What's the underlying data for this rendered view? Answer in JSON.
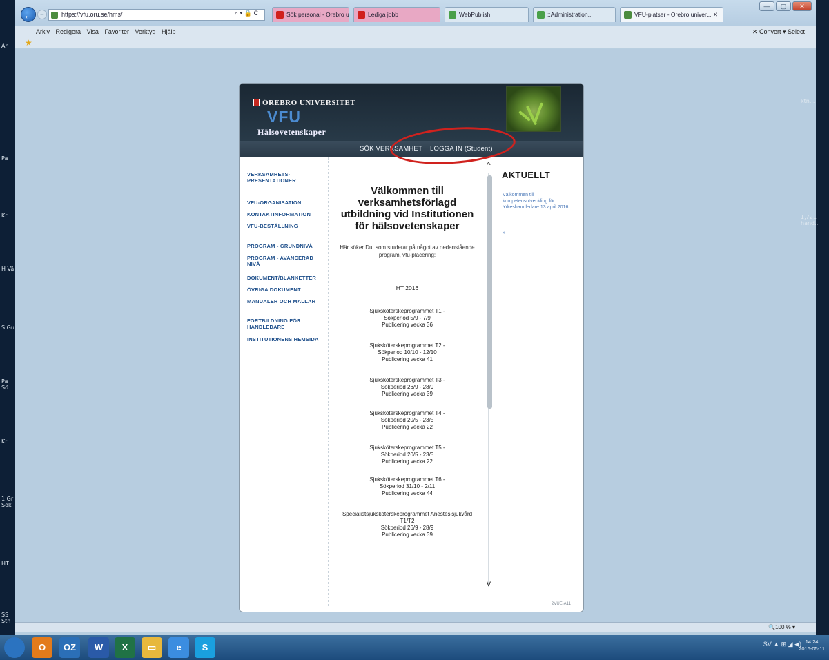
{
  "browser": {
    "url": "https://vfu.oru.se/hms/",
    "address_tools": "⌕ ▾ 🔒 C",
    "tabs": [
      {
        "label": "Sök personal - Örebro universi...",
        "color": "#e8a8c4",
        "icon_color": "#d0201c"
      },
      {
        "label": "Lediga jobb",
        "color": "#e8a8c4",
        "icon_color": "#d0201c"
      },
      {
        "label": "WebPublish",
        "color": "#dce8f2",
        "icon_color": "#4aa04a"
      },
      {
        "label": "::Administration...",
        "color": "#dce8f2",
        "icon_color": "#4aa04a"
      },
      {
        "label": "VFU-platser - Örebro univer... ✕",
        "color": "#f2f6fa",
        "icon_color": "#4c8c3f"
      }
    ],
    "menu": [
      "Arkiv",
      "Redigera",
      "Visa",
      "Favoriter",
      "Verktyg",
      "Hjälp"
    ],
    "menu_right": "✕  Convert ▾  Select",
    "zoom": "🔍100 % ▾",
    "window_buttons": {
      "minimize": "—",
      "maximize": "▢",
      "close": "✕"
    }
  },
  "site": {
    "university": "ÖREBRO UNIVERSITET",
    "title": "VFU",
    "subtitle": "Hälsovetenskaper",
    "nav": {
      "search": "SÖK VERKSAMHET",
      "login": "LOGGA IN (Student)"
    },
    "left_menu": [
      "VERKSAMHETS-PRESENTATIONER",
      "VFU-ORGANISATION",
      "KONTAKTINFORMATION",
      "VFU-BESTÄLLNING",
      "PROGRAM - GRUNDNIVÅ",
      "PROGRAM - AVANCERAD NIVÅ",
      "DOKUMENT/BLANKETTER",
      "ÖVRIGA DOKUMENT",
      "MANUALER OCH MALLAR",
      "FORTBILDNING FÖR HANDLEDARE",
      "INSTITUTIONENS HEMSIDA"
    ],
    "welcome": "Välkommen till verksamhetsförlagd utbildning vid Institutionen för hälsovetenskaper",
    "intro": "Här söker Du, som studerar på något av nedanstående program, vfu-placering:",
    "term": "HT 2016",
    "programs": [
      {
        "name": "Sjuksköterskeprogrammet T1 -",
        "period": "Sökperiod 5/9 - 7/9",
        "publish": "Publicering vecka 36"
      },
      {
        "name": "Sjuksköterskeprogrammet T2 -",
        "period": "Sökperiod 10/10 - 12/10",
        "publish": "Publicering vecka 41"
      },
      {
        "name": "Sjuksköterskeprogrammet T3 -",
        "period": "Sökperiod 26/9 - 28/9",
        "publish": "Publicering vecka 39"
      },
      {
        "name": "Sjuksköterskeprogrammet T4 -",
        "period": "Sökperiod 20/5 - 23/5",
        "publish": "Publicering vecka 22"
      },
      {
        "name": "Sjuksköterskeprogrammet T5 -",
        "period": "Sökperiod 20/5 - 23/5",
        "publish": "Publicering vecka 22"
      },
      {
        "name": "Sjuksköterskeprogrammet T6 -",
        "period": "Sökperiod 31/10 - 2/11",
        "publish": "Publicering vecka 44"
      },
      {
        "name": "Specialistsjuksköterskeprogrammet Anestesisjukvård T1/T2",
        "period": "Sökperiod 26/9 - 28/9",
        "publish": "Publicering vecka 39"
      }
    ],
    "aktuellt": "AKTUELLT",
    "news": "Välkommen till kompetensutveckling för Yrkeshandledare 13 april 2016",
    "news_more": "»",
    "footer": "2VUE-A11"
  },
  "desktop": {
    "left_labels": [
      "An",
      "Pa",
      "Kr",
      "H Vä",
      "S Gu",
      "Pa Sö",
      "Kr",
      "1 Gr Sök",
      "HT",
      "SS Stn"
    ],
    "right_labels": [
      "ktn...",
      "1,721 hand..."
    ]
  },
  "taskbar": {
    "apps": [
      {
        "name": "start-button",
        "label": "",
        "color": "#2b73c0"
      },
      {
        "name": "outlook-icon",
        "label": "O",
        "color": "#e37b1c"
      },
      {
        "name": "outlook-mail-icon",
        "label": "OZ",
        "color": "#2b6fb7"
      },
      {
        "name": "word-icon",
        "label": "W",
        "color": "#2a5aa8"
      },
      {
        "name": "excel-icon",
        "label": "X",
        "color": "#207245"
      },
      {
        "name": "explorer-icon",
        "label": "▭",
        "color": "#e7b83d"
      },
      {
        "name": "ie-icon",
        "label": "e",
        "color": "#3b8de0"
      },
      {
        "name": "skype-icon",
        "label": "S",
        "color": "#1aa0df"
      }
    ],
    "tray": "SV ▲ ⊞ ◢ ◀)",
    "time": "14:24",
    "date": "2016-05-11"
  }
}
